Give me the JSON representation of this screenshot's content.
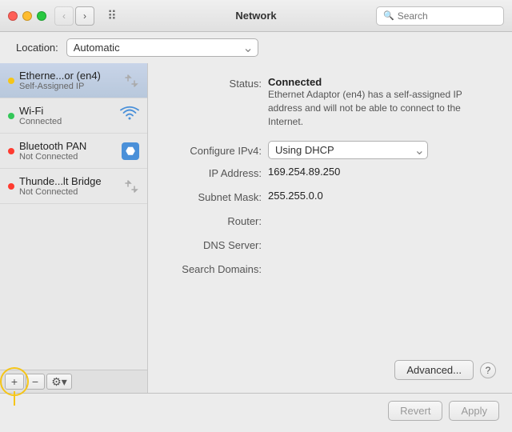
{
  "titlebar": {
    "title": "Network",
    "search_placeholder": "Search",
    "back_btn": "‹",
    "forward_btn": "›"
  },
  "location": {
    "label": "Location:",
    "value": "Automatic"
  },
  "sidebar": {
    "items": [
      {
        "id": "ethernet",
        "name": "Etherne...or (en4)",
        "sub": "Self-Assigned IP",
        "status": "yellow",
        "icon_type": "arrows",
        "active": true
      },
      {
        "id": "wifi",
        "name": "Wi-Fi",
        "sub": "Connected",
        "status": "green",
        "icon_type": "wifi",
        "active": false
      },
      {
        "id": "bluetooth",
        "name": "Bluetooth PAN",
        "sub": "Not Connected",
        "status": "red",
        "icon_type": "bluetooth",
        "active": false
      },
      {
        "id": "thunderbolt",
        "name": "Thunde...lt Bridge",
        "sub": "Not Connected",
        "status": "red",
        "icon_type": "arrows",
        "active": false
      }
    ],
    "add_label": "+",
    "remove_label": "−",
    "gear_label": "⚙"
  },
  "detail": {
    "status_label": "Status:",
    "status_value": "Connected",
    "status_desc": "Ethernet Adaptor (en4) has a self-assigned IP address and will not be able to connect to the Internet.",
    "configure_label": "Configure IPv4:",
    "configure_value": "Using DHCP",
    "ip_label": "IP Address:",
    "ip_value": "169.254.89.250",
    "subnet_label": "Subnet Mask:",
    "subnet_value": "255.255.0.0",
    "router_label": "Router:",
    "router_value": "",
    "dns_label": "DNS Server:",
    "dns_value": "",
    "search_domains_label": "Search Domains:",
    "search_domains_value": ""
  },
  "buttons": {
    "advanced": "Advanced...",
    "help": "?",
    "revert": "Revert",
    "apply": "Apply"
  }
}
